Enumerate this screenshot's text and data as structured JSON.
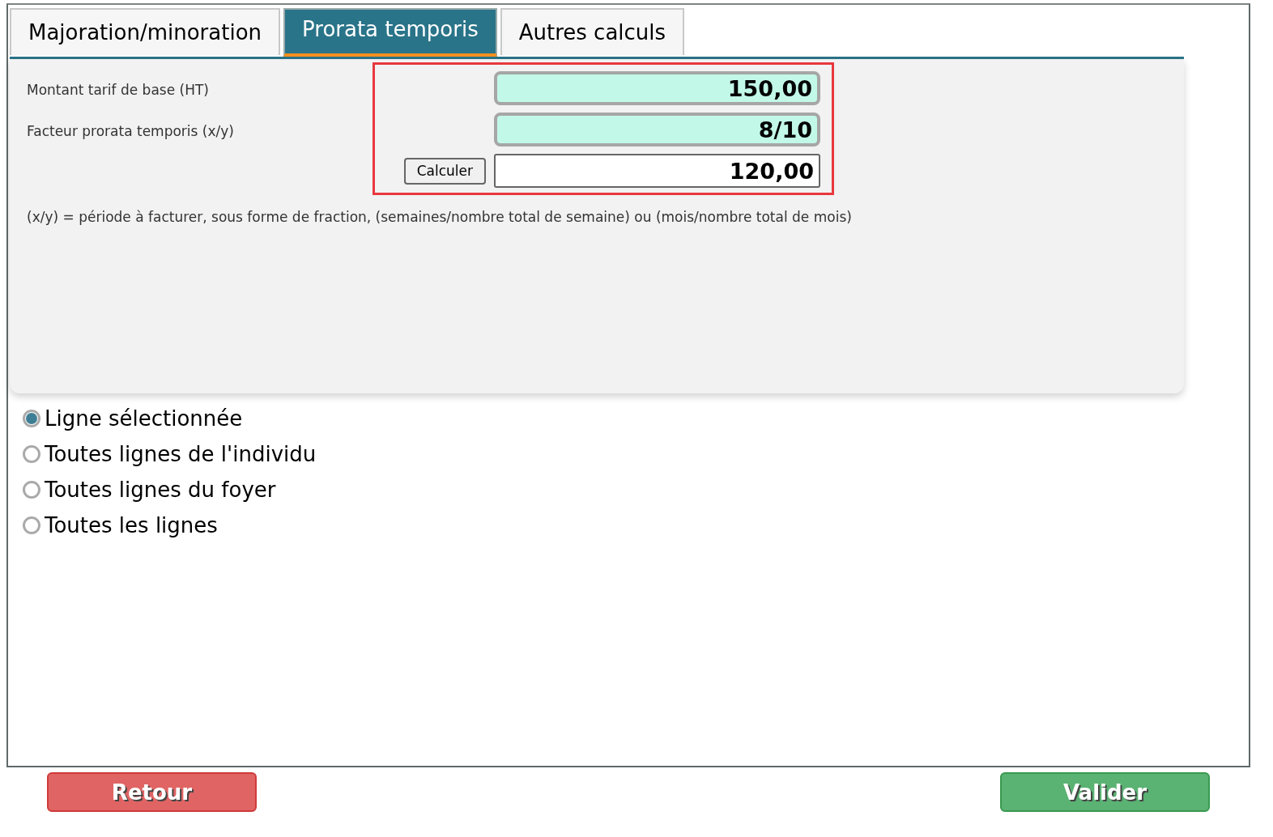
{
  "tabs": [
    {
      "label": "Majoration/minoration",
      "selected": false
    },
    {
      "label": "Prorata temporis",
      "selected": true
    },
    {
      "label": "Autres calculs",
      "selected": false
    }
  ],
  "form": {
    "labels": [
      "Montant tarif de base (HT)",
      "Facteur prorata temporis (x/y)"
    ],
    "fields": [
      {
        "value": "150,00",
        "kind": "input"
      },
      {
        "value": "8/10",
        "kind": "input"
      },
      {
        "value": "120,00",
        "kind": "result"
      }
    ],
    "calculate_button": "Calculer",
    "note": "(x/y) = période à facturer, sous forme de fraction, (semaines/nombre total de semaine) ou (mois/nombre total de mois)"
  },
  "scope_options": [
    {
      "label": "Ligne sélectionnée",
      "selected": true
    },
    {
      "label": "Toutes lignes de l'individu",
      "selected": false
    },
    {
      "label": "Toutes lignes du foyer",
      "selected": false
    },
    {
      "label": "Toutes les lignes",
      "selected": false
    }
  ],
  "buttons": {
    "back": "Retour",
    "validate": "Valider"
  }
}
